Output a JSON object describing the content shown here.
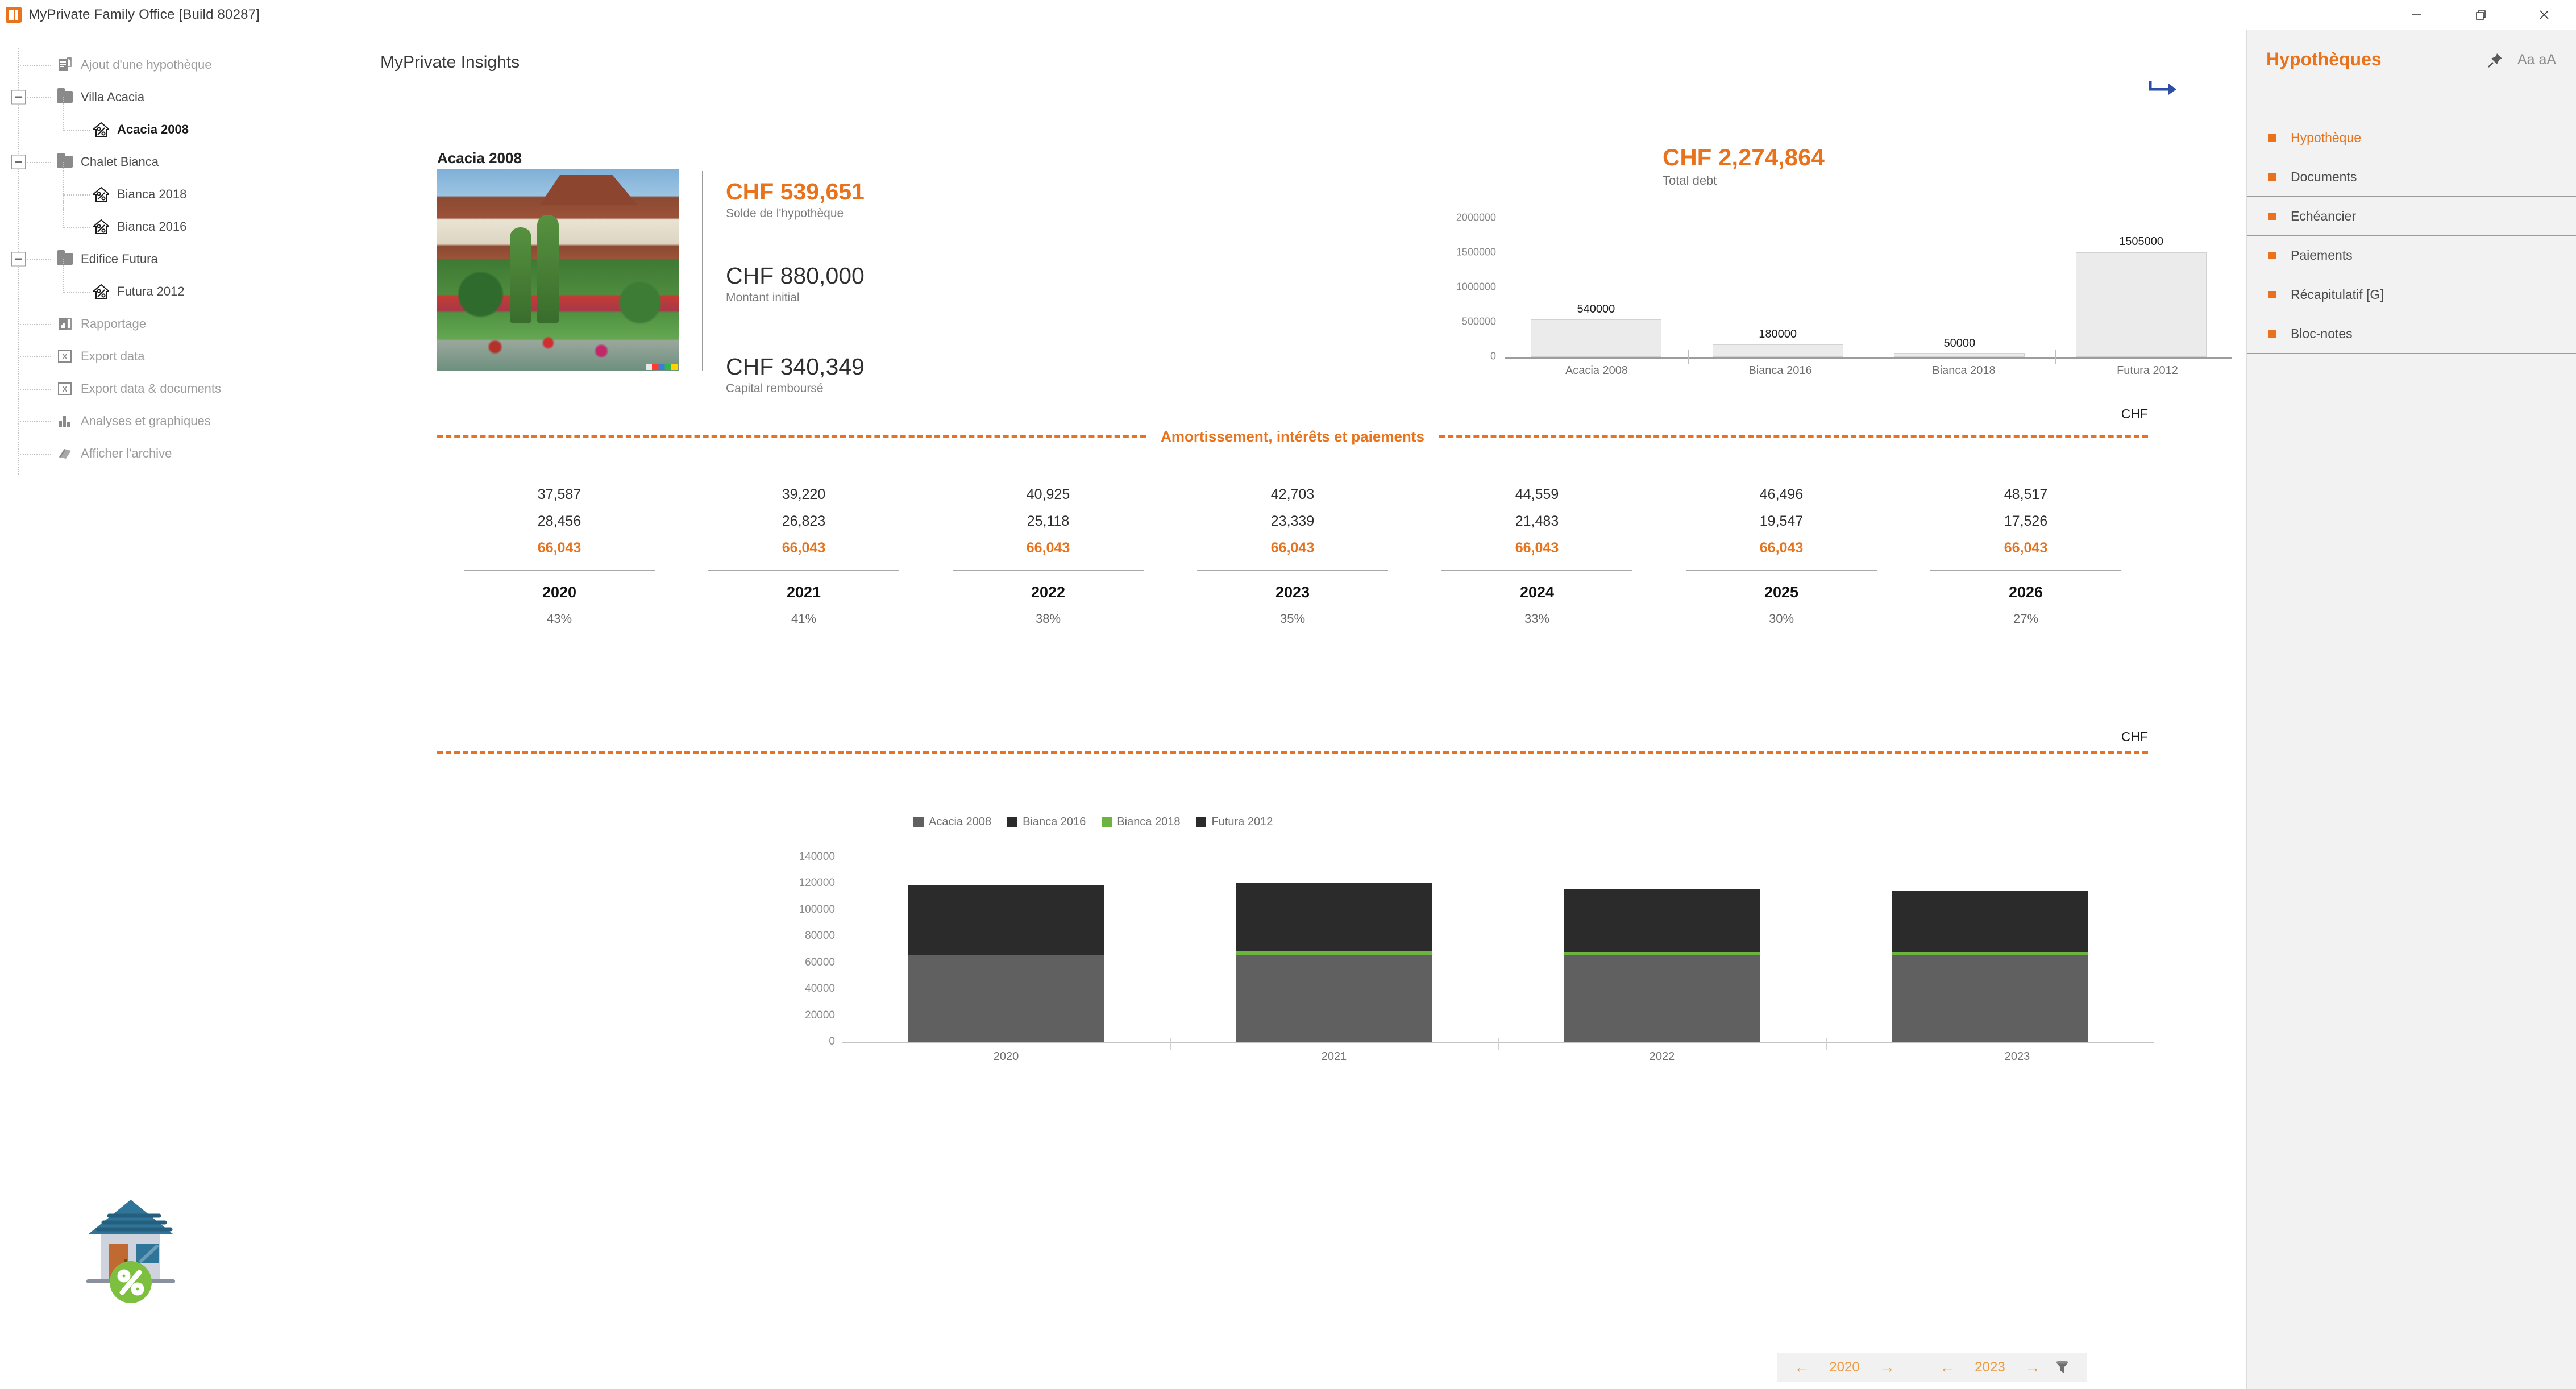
{
  "window": {
    "title": "MyPrivate Family Office [Build 80287]",
    "app_icon": "myprivate-logo-icon",
    "minimize_label": "minimize-icon",
    "maximize_label": "restore-icon",
    "close_label": "close-icon"
  },
  "sidebar": {
    "items": [
      {
        "label": "Ajout d'une hypothèque",
        "icon": "add-document-icon",
        "level": 1,
        "state": "muted",
        "expandable": false
      },
      {
        "label": "Villa Acacia",
        "icon": "folder-icon",
        "level": 1,
        "state": "normal",
        "expandable": true
      },
      {
        "label": "Acacia 2008",
        "icon": "house-percent-icon",
        "level": 2,
        "state": "active",
        "expandable": false
      },
      {
        "label": "Chalet Bianca",
        "icon": "folder-icon",
        "level": 1,
        "state": "normal",
        "expandable": true
      },
      {
        "label": "Bianca 2018",
        "icon": "house-percent-icon",
        "level": 2,
        "state": "normal",
        "expandable": false
      },
      {
        "label": "Bianca 2016",
        "icon": "house-percent-icon",
        "level": 2,
        "state": "normal",
        "expandable": false
      },
      {
        "label": "Edifice Futura",
        "icon": "folder-icon",
        "level": 1,
        "state": "normal",
        "expandable": true
      },
      {
        "label": "Futura 2012",
        "icon": "house-percent-icon",
        "level": 2,
        "state": "normal",
        "expandable": false
      },
      {
        "label": "Rapportage",
        "icon": "report-icon",
        "level": 1,
        "state": "muted",
        "expandable": false
      },
      {
        "label": "Export data",
        "icon": "excel-export-icon",
        "level": 1,
        "state": "muted",
        "expandable": false
      },
      {
        "label": "Export data & documents",
        "icon": "excel-export-icon",
        "level": 1,
        "state": "muted",
        "expandable": false
      },
      {
        "label": "Analyses et graphiques",
        "icon": "bar-chart-icon",
        "level": 1,
        "state": "muted",
        "expandable": false
      },
      {
        "label": "Afficher l'archive",
        "icon": "archive-book-icon",
        "level": 1,
        "state": "muted",
        "expandable": false
      }
    ],
    "footer_icon": "house-percent-badge-icon"
  },
  "main": {
    "page_title": "MyPrivate Insights",
    "forward_icon": "forward-arrow-icon",
    "card_title": "Acacia 2008",
    "photo_alt": "villa-photo",
    "kpis": [
      {
        "value": "CHF 539,651",
        "label": "Solde de l'hypothèque",
        "accent": true
      },
      {
        "value": "CHF 880,000",
        "label": "Montant initial",
        "accent": false
      },
      {
        "value": "CHF 340,349",
        "label": "Capital remboursé",
        "accent": false
      }
    ],
    "total_debt": {
      "value": "CHF  2,274,864",
      "label": "Total debt"
    },
    "amortization": {
      "title": "Amortissement, intérêts et paiements",
      "unit": "CHF",
      "columns": [
        {
          "year": "2020",
          "amortization": "37,587",
          "interest": "28,456",
          "payment": "66,043",
          "ratio": "43%"
        },
        {
          "year": "2021",
          "amortization": "39,220",
          "interest": "26,823",
          "payment": "66,043",
          "ratio": "41%"
        },
        {
          "year": "2022",
          "amortization": "40,925",
          "interest": "25,118",
          "payment": "66,043",
          "ratio": "38%"
        },
        {
          "year": "2023",
          "amortization": "42,703",
          "interest": "23,339",
          "payment": "66,043",
          "ratio": "35%"
        },
        {
          "year": "2024",
          "amortization": "44,559",
          "interest": "21,483",
          "payment": "66,043",
          "ratio": "33%"
        },
        {
          "year": "2025",
          "amortization": "46,496",
          "interest": "19,547",
          "payment": "66,043",
          "ratio": "30%"
        },
        {
          "year": "2026",
          "amortization": "48,517",
          "interest": "17,526",
          "payment": "66,043",
          "ratio": "27%"
        }
      ]
    },
    "lower_band": {
      "unit": "CHF"
    },
    "pager": {
      "left_prev": "←",
      "left_value": "2020",
      "left_next": "→",
      "right_prev": "←",
      "right_value": "2023",
      "right_next": "→",
      "filter_icon": "filter-icon"
    },
    "back_button": "back-circle-icon"
  },
  "right_panel": {
    "title": "Hypothèques",
    "pin_icon": "pin-icon",
    "font_size_label": "Aa aA",
    "items": [
      {
        "label": "Hypothèque",
        "selected": true
      },
      {
        "label": "Documents",
        "selected": false
      },
      {
        "label": "Echéancier",
        "selected": false
      },
      {
        "label": "Paiements",
        "selected": false
      },
      {
        "label": "Récapitulatif [G]",
        "selected": false
      },
      {
        "label": "Bloc-notes",
        "selected": false
      }
    ]
  },
  "colors": {
    "accent": "#E8731C",
    "accent_light": "#EE9A3F",
    "panel_bg": "#f2f2f2",
    "series_acacia": "#606060",
    "series_bianca2016": "#2b2b2b",
    "series_bianca2018": "#6cb33f",
    "series_futura2012": "#2b2b2b"
  },
  "chart_data": [
    {
      "type": "bar",
      "name": "total-debt-by-mortgage",
      "title": "",
      "categories": [
        "Acacia 2008",
        "Bianca 2016",
        "Bianca 2018",
        "Futura 2012"
      ],
      "values": [
        540000,
        180000,
        50000,
        1505000
      ],
      "data_labels": [
        "540000",
        "180000",
        "50000",
        "1505000"
      ],
      "ylabel": "",
      "xlabel": "",
      "ylim": [
        0,
        2000000
      ],
      "yticks": [
        0,
        500000,
        1000000,
        1500000,
        2000000
      ],
      "ytick_labels": [
        "0",
        "500000",
        "1000000",
        "1500000",
        "2000000"
      ],
      "grid": false,
      "legend": "none",
      "bar_color": "#ebebeb"
    },
    {
      "type": "bar",
      "name": "payments-by-year-stacked",
      "stacked": true,
      "title": "",
      "categories": [
        "2020",
        "2021",
        "2022",
        "2023"
      ],
      "series": [
        {
          "name": "Acacia 2008",
          "color": "#606060",
          "values": [
            66043,
            66043,
            66043,
            66043
          ]
        },
        {
          "name": "Bianca 2016",
          "color": "#2b2b2b",
          "values": [
            52500,
            53500,
            49500,
            46500
          ]
        },
        {
          "name": "Bianca 2018",
          "color": "#6cb33f",
          "values": [
            0,
            1200,
            1200,
            1500
          ]
        },
        {
          "name": "Futura 2012",
          "color": "#2b2b2b",
          "values": [
            0,
            0,
            0,
            0
          ]
        }
      ],
      "ylabel": "",
      "xlabel": "",
      "ylim": [
        0,
        140000
      ],
      "yticks": [
        0,
        20000,
        40000,
        60000,
        80000,
        100000,
        120000,
        140000
      ],
      "ytick_labels": [
        "0",
        "20000",
        "40000",
        "60000",
        "80000",
        "100000",
        "120000",
        "140000"
      ],
      "totals": [
        118543,
        120743,
        116743,
        114043
      ],
      "grid": false,
      "legend": "top-right"
    }
  ]
}
